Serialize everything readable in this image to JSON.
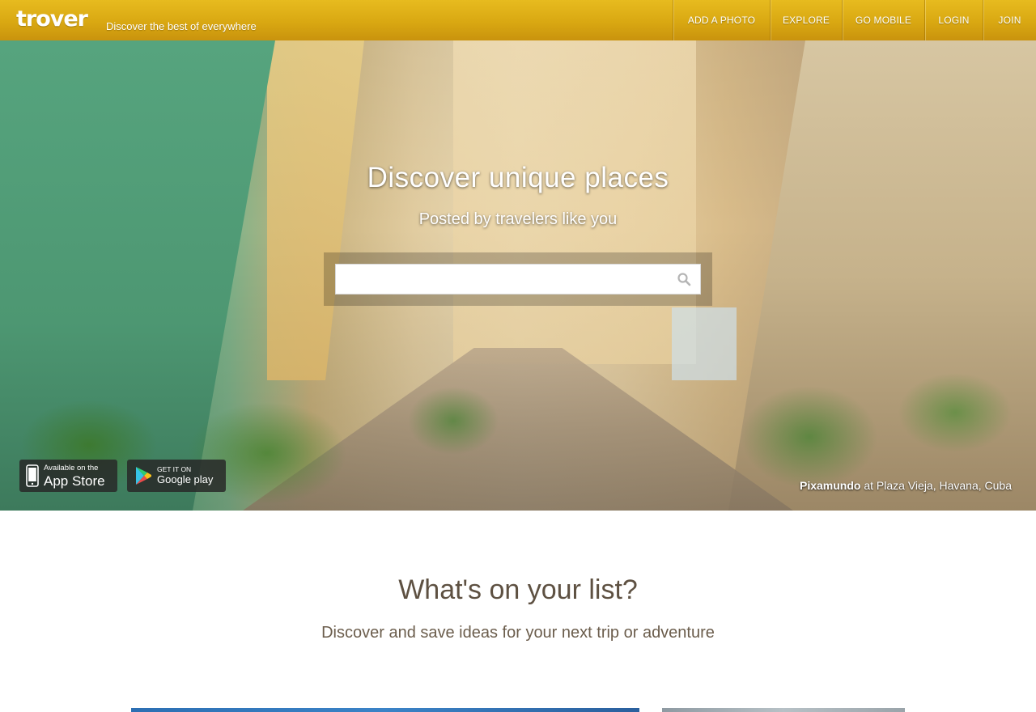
{
  "header": {
    "logo": "trover",
    "tagline": "Discover the best of everywhere",
    "nav": [
      {
        "label": "ADD A PHOTO"
      },
      {
        "label": "EXPLORE"
      },
      {
        "label": "GO MOBILE"
      },
      {
        "label": "LOGIN"
      },
      {
        "label": "JOIN"
      }
    ],
    "colors": {
      "bar": "#dcae17",
      "text": "#ffffff"
    }
  },
  "hero": {
    "title": "Discover unique places",
    "subtitle": "Posted by travelers like you",
    "search": {
      "value": "",
      "placeholder": "",
      "icon": "search-icon"
    },
    "app_store": {
      "small": "Available on the",
      "big": "App Store",
      "icon": "phone-icon"
    },
    "google_play": {
      "small": "GET IT ON",
      "big": "Google play",
      "icon": "play-store-icon"
    },
    "credit": {
      "author": "Pixamundo",
      "location": "at Plaza Vieja, Havana, Cuba"
    }
  },
  "list_section": {
    "title": "What's on your list?",
    "subtitle": "Discover and save ideas for your next trip or adventure"
  }
}
